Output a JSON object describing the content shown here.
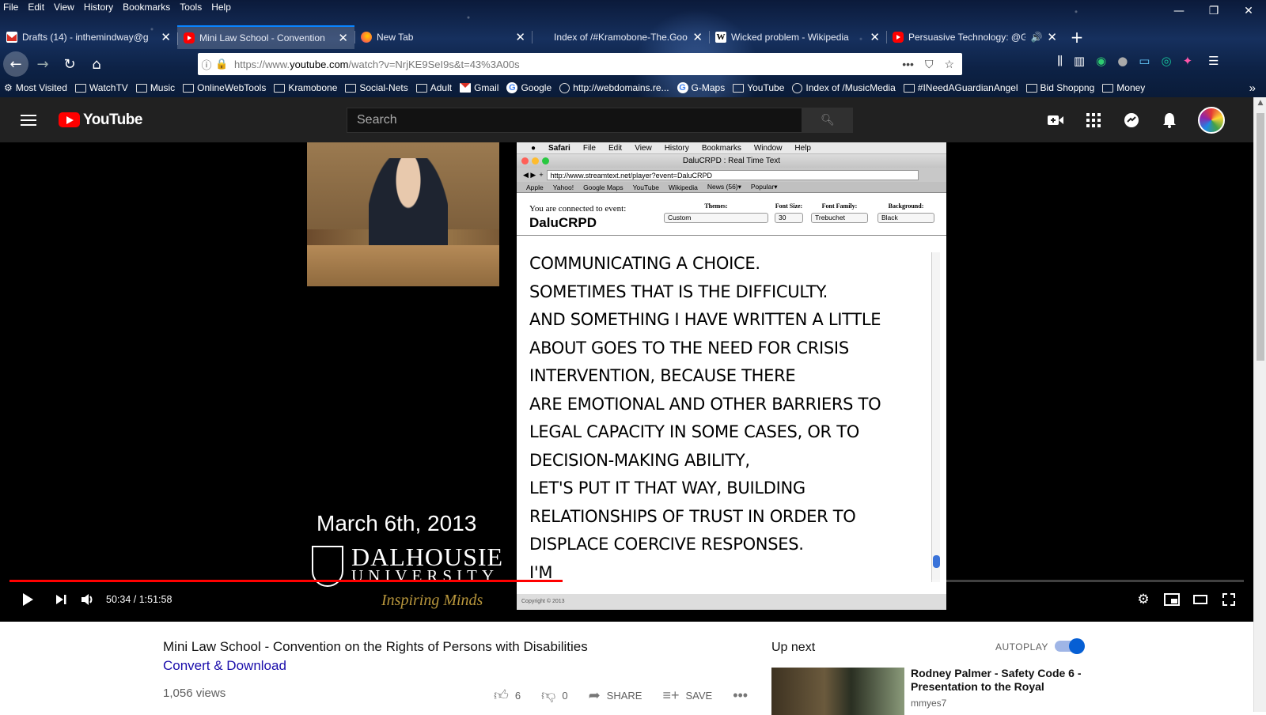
{
  "menubar": [
    "File",
    "Edit",
    "View",
    "History",
    "Bookmarks",
    "Tools",
    "Help"
  ],
  "tabs": [
    {
      "title": "Drafts (14) - inthemindway@g",
      "favicon": "gmail-icon",
      "color": "#d93025",
      "active": false
    },
    {
      "title": "Mini Law School - Convention",
      "favicon": "youtube-icon",
      "color": "#ff0000",
      "active": true
    },
    {
      "title": "New Tab",
      "favicon": "firefox-icon",
      "color": "#ff7139",
      "active": false
    },
    {
      "title": "Index of /#Kramobone-The.Good/",
      "favicon": "globe-icon",
      "color": "",
      "active": false
    },
    {
      "title": "Wicked problem - Wikipedia",
      "favicon": "wikipedia-icon",
      "color": "#ffffff",
      "active": false
    },
    {
      "title": "Persuasive Technology: @G",
      "favicon": "youtube-icon",
      "color": "#ff0000",
      "active": false
    }
  ],
  "address": {
    "prefix": "https://www.",
    "domain": "youtube.com",
    "path": "/watch?v=NrjKE9SeI9s&t=43%3A00s"
  },
  "bookmarks": [
    {
      "label": "Most Visited",
      "icon": "gear-icon"
    },
    {
      "label": "WatchTV",
      "icon": "folder-icon"
    },
    {
      "label": "Music",
      "icon": "folder-icon"
    },
    {
      "label": "OnlineWebTools",
      "icon": "folder-icon"
    },
    {
      "label": "Kramobone",
      "icon": "folder-icon"
    },
    {
      "label": "Social-Nets",
      "icon": "folder-icon"
    },
    {
      "label": "Adult",
      "icon": "folder-icon"
    },
    {
      "label": "Gmail",
      "icon": "gmail-icon"
    },
    {
      "label": "Google",
      "icon": "google-icon"
    },
    {
      "label": "http://webdomains.re...",
      "icon": "globe-icon"
    },
    {
      "label": "G-Maps",
      "icon": "google-icon"
    },
    {
      "label": "YouTube",
      "icon": "folder-icon"
    },
    {
      "label": "Index of /MusicMedia",
      "icon": "globe-icon"
    },
    {
      "label": "#INeedAGuardianAngel",
      "icon": "folder-icon"
    },
    {
      "label": "Bid Shoppng",
      "icon": "folder-icon"
    },
    {
      "label": "Money",
      "icon": "folder-icon"
    }
  ],
  "youtube": {
    "logo": "YouTube",
    "search_placeholder": "Search"
  },
  "video": {
    "overlay_date": "March 6th, 2013",
    "dal_line1": "DALHOUSIE",
    "dal_line2": "UNIVERSITY",
    "dal_line3": "Inspiring Minds",
    "safari_menu": [
      "Safari",
      "File",
      "Edit",
      "View",
      "History",
      "Bookmarks",
      "Window",
      "Help"
    ],
    "safari_title": "DaluCRPD : Real Time Text",
    "safari_url": "http://www.streamtext.net/player?event=DaluCRPD",
    "safari_bookmarks": [
      "Apple",
      "Yahoo!",
      "Google Maps",
      "YouTube",
      "Wikipedia",
      "News (56)▾",
      "Popular▾"
    ],
    "connected_label": "You are connected to event:",
    "event_name": "DaluCRPD",
    "controls": [
      {
        "label": "Themes:",
        "value": "Custom"
      },
      {
        "label": "Font Size:",
        "value": "30"
      },
      {
        "label": "Font Family:",
        "value": "Trebuchet"
      },
      {
        "label": "Background:",
        "value": "Black"
      }
    ],
    "caption_lines": [
      "COMMUNICATING A CHOICE.",
      "SOMETIMES THAT IS THE DIFFICULTY.",
      "AND SOMETHING I HAVE WRITTEN A LITTLE",
      "ABOUT GOES TO THE NEED FOR CRISIS",
      "INTERVENTION, BECAUSE THERE",
      "ARE EMOTIONAL AND OTHER BARRIERS TO",
      "LEGAL CAPACITY IN SOME CASES, OR TO",
      "DECISION-MAKING ABILITY,",
      "LET'S PUT IT THAT WAY, BUILDING",
      "RELATIONSHIPS OF TRUST IN ORDER TO",
      "DISPLACE COERCIVE RESPONSES.",
      "I'M"
    ],
    "footer": "Copyright © 2013",
    "time": "50:34 / 1:51:58",
    "played_fraction": 0.4478,
    "buffered_fraction": 0.4625
  },
  "info": {
    "title": "Mini Law School - Convention on the Rights of Persons with Disabilities",
    "convert": "Convert & Download",
    "views": "1,056 views",
    "likes": "6",
    "dislikes": "0",
    "share": "SHARE",
    "save": "SAVE"
  },
  "sidebar": {
    "up_next": "Up next",
    "autoplay": "AUTOPLAY",
    "rec_title": "Rodney Palmer - Safety Code 6 - Presentation to the Royal",
    "rec_channel": "mmyes7"
  }
}
